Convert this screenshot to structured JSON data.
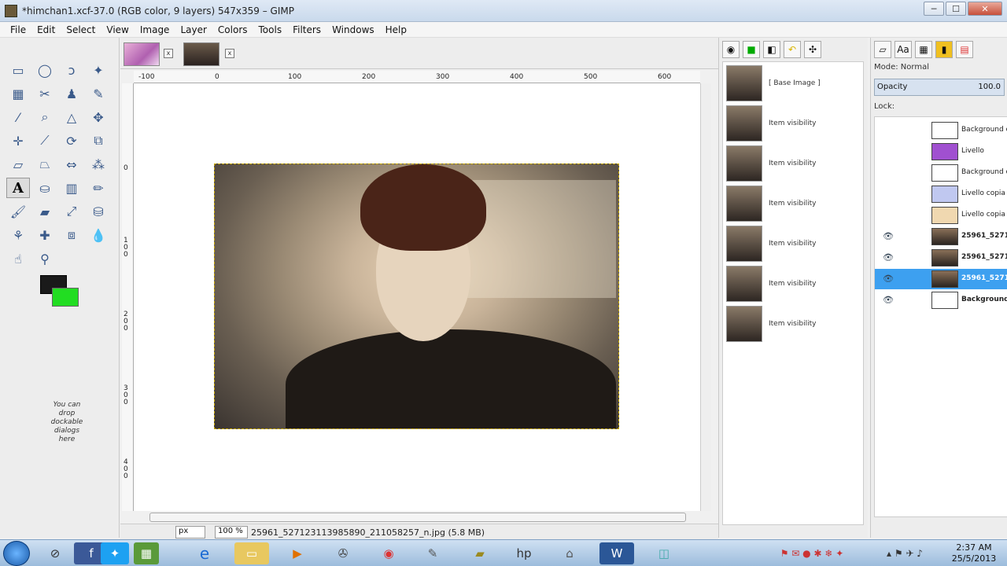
{
  "window": {
    "title": "*himchan1.xcf-37.0 (RGB color, 9 layers) 547x359 – GIMP",
    "minimize": "─",
    "maximize": "☐",
    "close": "✕"
  },
  "menu": [
    "File",
    "Edit",
    "Select",
    "View",
    "Image",
    "Layer",
    "Colors",
    "Tools",
    "Filters",
    "Windows",
    "Help"
  ],
  "toolbox": {
    "text_tool_glyph": "A",
    "dock_hint": "You can drop dockable dialogs here",
    "fg_color": "#1a1a1a",
    "bg_color": "#22dd22"
  },
  "tabs": {
    "close_glyph": "x"
  },
  "rulers": {
    "top": [
      "-100",
      "0",
      "100",
      "200",
      "300",
      "400",
      "500",
      "600"
    ],
    "left": [
      "0",
      "1 0 0",
      "2 0 0",
      "3 0 0",
      "4 0 0"
    ]
  },
  "status": {
    "unit": "px",
    "zoom": "100 %",
    "file": "25961_527123113985890_211058257_n.jpg (5.8 MB)"
  },
  "undo_history": [
    "[ Base Image ]",
    "Item visibility",
    "Item visibility",
    "Item visibility",
    "Item visibility",
    "Item visibility",
    "Item visibility"
  ],
  "layers_panel": {
    "mode": "Mode: Normal",
    "opacity_label": "Opacity",
    "opacity_value": "100.0",
    "lock_label": "Lock:",
    "layers": [
      {
        "name": "Background c",
        "visible": false,
        "bold": false,
        "thumb": "fill"
      },
      {
        "name": "Livello",
        "visible": false,
        "bold": false,
        "thumb": "purple"
      },
      {
        "name": "Background c",
        "visible": false,
        "bold": false,
        "thumb": "fill"
      },
      {
        "name": "Livello copia c",
        "visible": false,
        "bold": false,
        "thumb": "lav"
      },
      {
        "name": "Livello copia",
        "visible": false,
        "bold": false,
        "thumb": "peach"
      },
      {
        "name": "25961_52712",
        "visible": true,
        "bold": true,
        "thumb": "photo"
      },
      {
        "name": "25961_52712",
        "visible": true,
        "bold": true,
        "thumb": "photo"
      },
      {
        "name": "25961_52712",
        "visible": true,
        "bold": true,
        "thumb": "photo",
        "selected": true
      },
      {
        "name": "Background",
        "visible": true,
        "bold": true,
        "thumb": "fill"
      }
    ]
  },
  "taskbar": {
    "time": "2:37 AM",
    "date": "25/5/2013"
  }
}
